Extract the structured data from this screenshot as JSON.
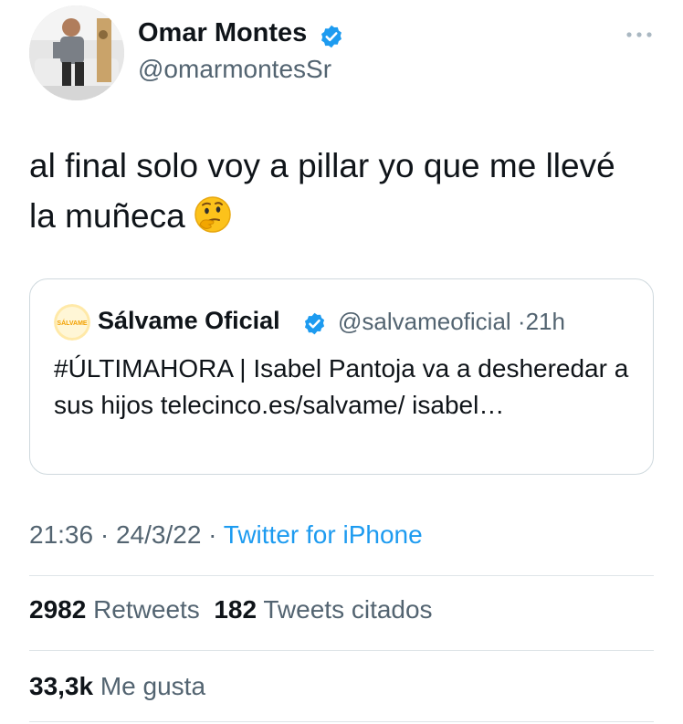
{
  "author": {
    "name": "Omar Montes",
    "handle": "@omarmontesSr",
    "verified": true
  },
  "tweet": {
    "text": "al final solo voy a pillar yo que me llevé la muñeca",
    "emoji": "thinking-face"
  },
  "quote": {
    "name": "Sálvame Oficial",
    "handle": "@salvameoficial",
    "separator": "·",
    "age": "21h",
    "text": "#ÚLTIMAHORA | Isabel Pantoja va a desheredar a sus hijos telecinco.es/salvame/ isabel…",
    "avatar_label": "SÁLVAME",
    "verified": true
  },
  "meta": {
    "time": "21:36",
    "date": "24/3/22",
    "separator": "·",
    "source": "Twitter for iPhone"
  },
  "stats": {
    "retweets_count": "2982",
    "retweets_label": "Retweets",
    "quotes_count": "182",
    "quotes_label": "Tweets citados",
    "likes_count": "33,3k",
    "likes_label": "Me gusta"
  },
  "colors": {
    "accent": "#1d9bf0",
    "secondary_text": "#536471",
    "primary_text": "#0f1419",
    "border": "#cfd9de"
  },
  "icons": {
    "verified": "verified-badge-icon",
    "more": "more-options-icon",
    "emoji": "thinking-face-icon"
  }
}
